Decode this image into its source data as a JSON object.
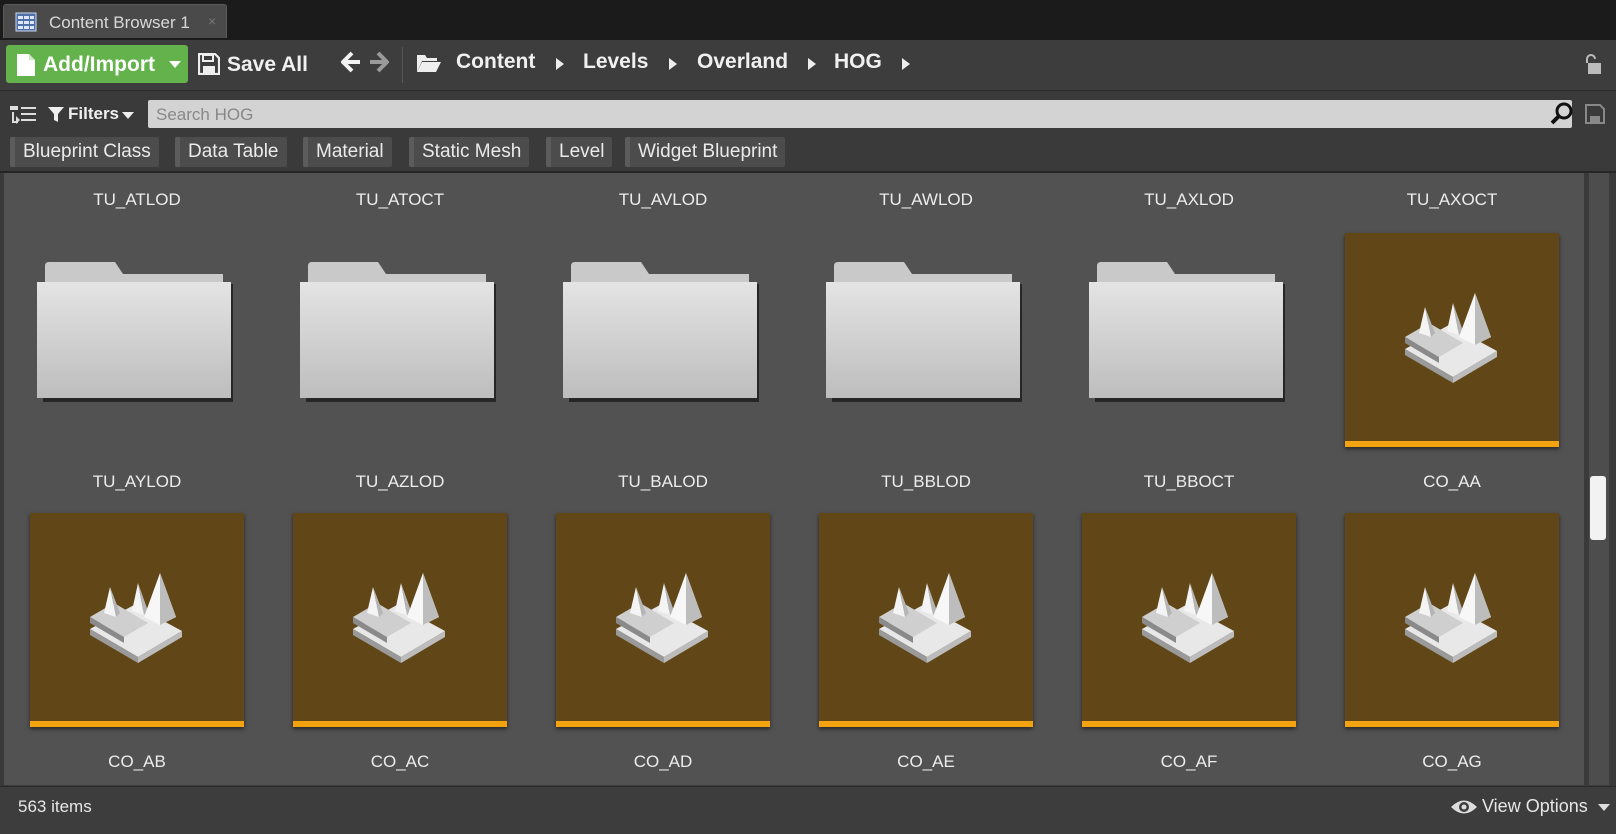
{
  "tab": {
    "title": "Content Browser 1",
    "close": "×",
    "icon": "content-browser-icon"
  },
  "toolbar": {
    "add_import_label": "Add/Import",
    "save_all_label": "Save All",
    "breadcrumbs": [
      "Content",
      "Levels",
      "Overland",
      "HOG"
    ]
  },
  "search": {
    "placeholder": "Search HOG",
    "value": ""
  },
  "filters": {
    "label": "Filters",
    "chips": [
      "Blueprint Class",
      "Data Table",
      "Material",
      "Static Mesh",
      "Level",
      "Widget Blueprint"
    ]
  },
  "grid": {
    "top_labels": [
      "TU_ATLOD",
      "TU_ATOCT",
      "TU_AVLOD",
      "TU_AWLOD",
      "TU_AXLOD",
      "TU_AXOCT"
    ],
    "row1": [
      {
        "name": "TU_AYLOD",
        "kind": "folder"
      },
      {
        "name": "TU_AZLOD",
        "kind": "folder"
      },
      {
        "name": "TU_BALOD",
        "kind": "folder"
      },
      {
        "name": "TU_BBLOD",
        "kind": "folder"
      },
      {
        "name": "TU_BBOCT",
        "kind": "folder"
      },
      {
        "name": "CO_AA",
        "kind": "level"
      }
    ],
    "row2": [
      {
        "name": "CO_AB",
        "kind": "level"
      },
      {
        "name": "CO_AC",
        "kind": "level"
      },
      {
        "name": "CO_AD",
        "kind": "level"
      },
      {
        "name": "CO_AE",
        "kind": "level"
      },
      {
        "name": "CO_AF",
        "kind": "level"
      },
      {
        "name": "CO_AG",
        "kind": "level"
      }
    ],
    "colors": {
      "level_bg": "#614718",
      "level_accent": "#f3a30f",
      "add_button": "#63b24c"
    }
  },
  "status": {
    "item_count": "563 items",
    "view_options": "View Options"
  }
}
